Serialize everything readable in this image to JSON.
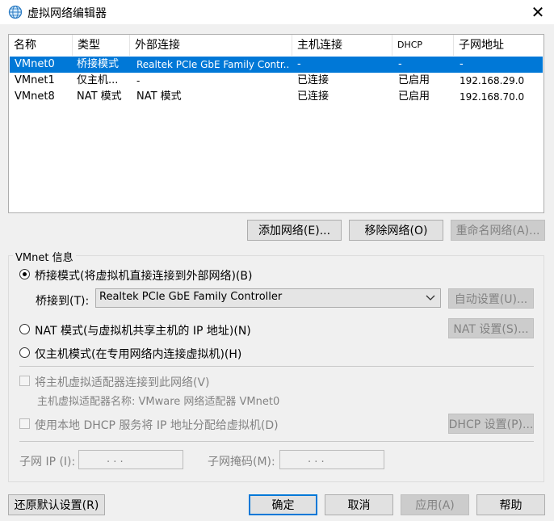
{
  "window": {
    "title": "虚拟网络编辑器",
    "close_glyph": "✕",
    "app_icon": "globe-icon"
  },
  "table": {
    "columns": [
      "名称",
      "类型",
      "外部连接",
      "主机连接",
      "DHCP",
      "子网地址"
    ],
    "rows": [
      {
        "name": "VMnet0",
        "type": "桥接模式",
        "external": "Realtek PCIe GbE Family Contr...",
        "host": "-",
        "dhcp": "-",
        "subnet": "-",
        "selected": true
      },
      {
        "name": "VMnet1",
        "type": "仅主机...",
        "external": "-",
        "host": "已连接",
        "dhcp": "已启用",
        "subnet": "192.168.29.0",
        "selected": false
      },
      {
        "name": "VMnet8",
        "type": "NAT 模式",
        "external": "NAT 模式",
        "host": "已连接",
        "dhcp": "已启用",
        "subnet": "192.168.70.0",
        "selected": false
      }
    ],
    "scroll_left": "<",
    "scroll_right": ">"
  },
  "list_buttons": {
    "add": "添加网络(E)...",
    "remove": "移除网络(O)",
    "rename": "重命名网络(A)..."
  },
  "info": {
    "group_label": "VMnet 信息",
    "bridged_label": "桥接模式(将虚拟机直接连接到外部网络)(B)",
    "bridge_to_label": "桥接到(T):",
    "bridge_to_value": "Realtek PCIe GbE Family Controller",
    "auto_settings": "自动设置(U)...",
    "nat_label": "NAT 模式(与虚拟机共享主机的 IP 地址)(N)",
    "nat_settings": "NAT 设置(S)...",
    "hostonly_label": "仅主机模式(在专用网络内连接虚拟机)(H)",
    "connect_adapter_label": "将主机虚拟适配器连接到此网络(V)",
    "adapter_name_label": "主机虚拟适配器名称: VMware 网络适配器 VMnet0",
    "dhcp_label": "使用本地 DHCP 服务将 IP 地址分配给虚拟机(D)",
    "dhcp_settings": "DHCP 设置(P)...",
    "subnet_ip_label": "子网 IP (I):",
    "subnet_ip_value": ". . .",
    "subnet_mask_label": "子网掩码(M):",
    "subnet_mask_value": ". . .",
    "mode_selected": "bridged"
  },
  "footer": {
    "restore": "还原默认设置(R)",
    "ok": "确定",
    "cancel": "取消",
    "apply": "应用(A)",
    "help": "帮助"
  },
  "colors": {
    "selection": "#0078d7",
    "disabled_text": "#838383"
  }
}
